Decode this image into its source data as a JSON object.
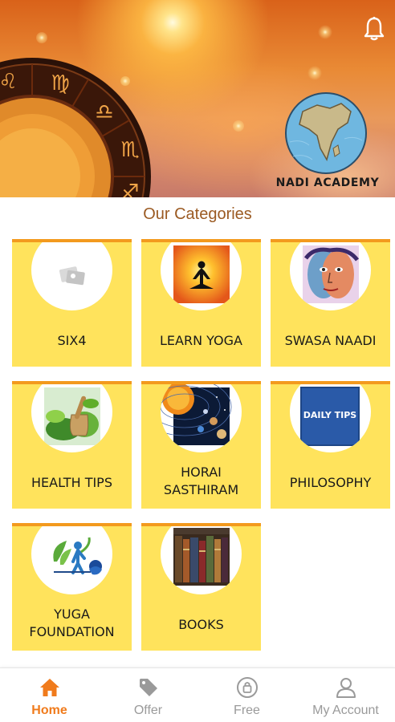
{
  "banner": {
    "logo_text": "NADI ACADEMY",
    "bell_icon": "bell-icon"
  },
  "section_title": "Our Categories",
  "categories": [
    {
      "label": "SIX4",
      "image": "six4-image"
    },
    {
      "label": "LEARN YOGA",
      "image": "yoga-meditation-image"
    },
    {
      "label": "SWASA NAADI",
      "image": "swasa-naadi-face-image"
    },
    {
      "label": "HEALTH TIPS",
      "image": "herbs-mortar-image"
    },
    {
      "label": "HORAI SASTHIRAM",
      "label_line1": "HORAI",
      "label_line2": "SASTHIRAM",
      "image": "planets-image"
    },
    {
      "label": "PHILOSOPHY",
      "image": "daily-tips-image",
      "image_text": "DAILY TIPS"
    },
    {
      "label": "YUGA FOUNDATION",
      "label_line1": "YUGA",
      "label_line2": "FOUNDATION",
      "image": "yuga-foundation-logo"
    },
    {
      "label": "BOOKS",
      "image": "books-image"
    }
  ],
  "nav": [
    {
      "label": "Home",
      "icon": "home-icon",
      "active": true
    },
    {
      "label": "Offer",
      "icon": "tag-icon",
      "active": false
    },
    {
      "label": "Free",
      "icon": "free-lock-icon",
      "active": false
    },
    {
      "label": "My Account",
      "icon": "user-icon",
      "active": false
    }
  ],
  "colors": {
    "card_bg": "#ffe35c",
    "card_border": "#f39a1e",
    "title": "#9b5a22",
    "nav_active": "#f07b1c",
    "nav_inactive": "#9a9a9a"
  }
}
